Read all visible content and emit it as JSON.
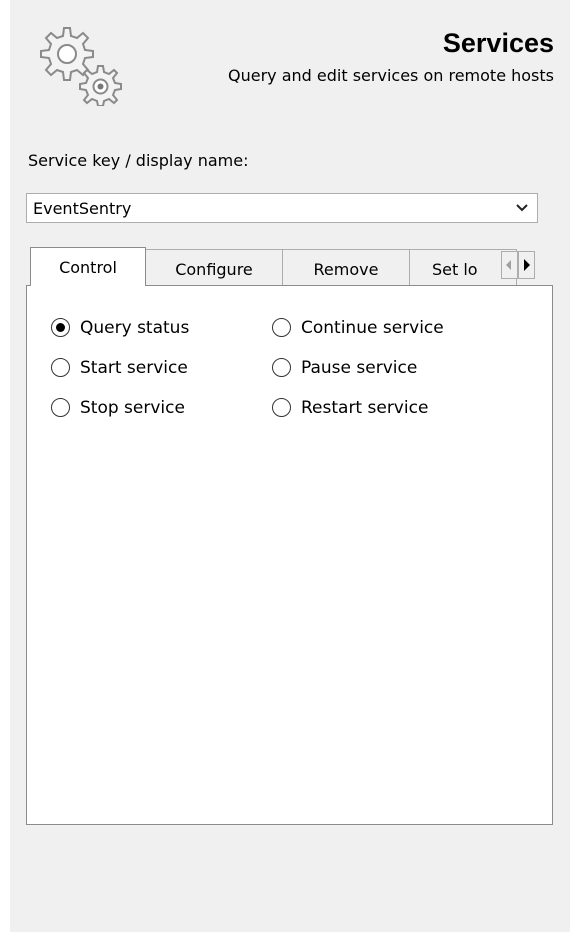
{
  "header": {
    "title": "Services",
    "subtitle": "Query and edit services on remote hosts",
    "icon": "gears-icon"
  },
  "service_field": {
    "label": "Service key / display name:",
    "value": "EventSentry"
  },
  "tabs": {
    "active": "Control",
    "items": [
      {
        "label": "Control"
      },
      {
        "label": "Configure"
      },
      {
        "label": "Remove"
      },
      {
        "label": "Set lo"
      }
    ]
  },
  "control": {
    "options": [
      {
        "label": "Query status",
        "checked": true
      },
      {
        "label": "Start service",
        "checked": false
      },
      {
        "label": "Stop service",
        "checked": false
      },
      {
        "label": "Continue service",
        "checked": false
      },
      {
        "label": "Pause service",
        "checked": false
      },
      {
        "label": "Restart service",
        "checked": false
      }
    ]
  }
}
